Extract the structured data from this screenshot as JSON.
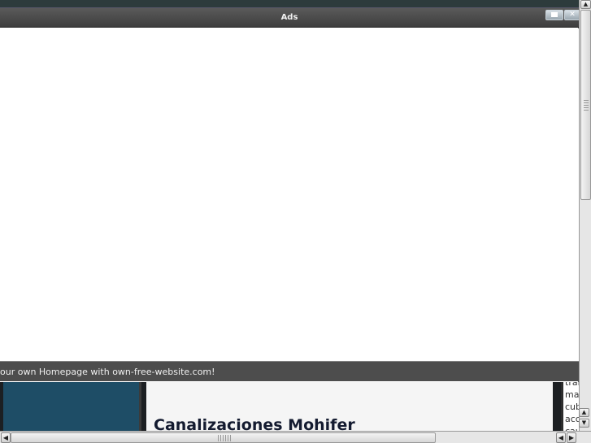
{
  "ad_window": {
    "title": "Ads",
    "footer_text": "our own Homepage with own-free-website.com!",
    "maximize_icon": "maximize-icon",
    "close_icon": "close-icon"
  },
  "page": {
    "content_title": "Canalizaciones Mohifer",
    "side_text_lines": [
      "trai",
      "max",
      "cub",
      "acc",
      "cau"
    ]
  },
  "scrollbars": {
    "vertical": {
      "up_icon": "arrow-up-icon",
      "down_icon": "arrow-down-icon"
    },
    "horizontal": {
      "left_icon": "arrow-left-icon",
      "right_icon": "arrow-right-icon"
    }
  }
}
